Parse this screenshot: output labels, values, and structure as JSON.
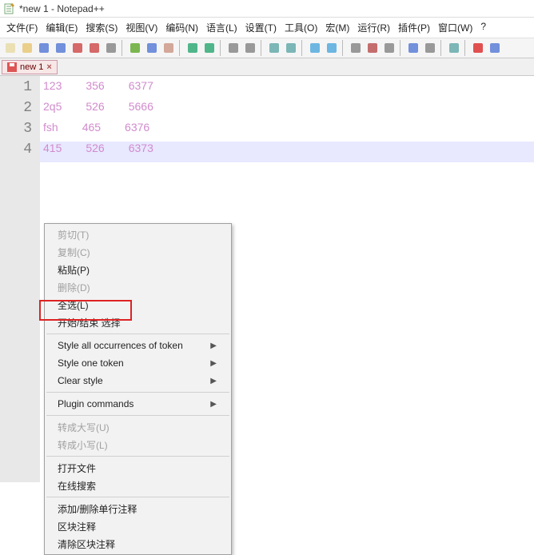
{
  "window": {
    "title": "*new 1 - Notepad++",
    "icon_name": "notepad-icon"
  },
  "menubar": {
    "items": [
      {
        "label": "文件(F)"
      },
      {
        "label": "编辑(E)"
      },
      {
        "label": "搜索(S)"
      },
      {
        "label": "视图(V)"
      },
      {
        "label": "编码(N)"
      },
      {
        "label": "语言(L)"
      },
      {
        "label": "设置(T)"
      },
      {
        "label": "工具(O)"
      },
      {
        "label": "宏(M)"
      },
      {
        "label": "运行(R)"
      },
      {
        "label": "插件(P)"
      },
      {
        "label": "窗口(W)"
      },
      {
        "label": "?"
      }
    ]
  },
  "toolbar": {
    "buttons": [
      {
        "name": "new-file-icon",
        "color": "#e8dca8"
      },
      {
        "name": "open-file-icon",
        "color": "#e8c878"
      },
      {
        "name": "save-icon",
        "color": "#5a7ed6"
      },
      {
        "name": "save-all-icon",
        "color": "#5a7ed6"
      },
      {
        "name": "close-icon",
        "color": "#d05050"
      },
      {
        "name": "close-all-icon",
        "color": "#d05050"
      },
      {
        "name": "print-icon",
        "color": "#888"
      },
      {
        "sep": true
      },
      {
        "name": "cut-icon",
        "color": "#6a3"
      },
      {
        "name": "copy-icon",
        "color": "#5a7ed6"
      },
      {
        "name": "paste-icon",
        "color": "#c98"
      },
      {
        "sep": true
      },
      {
        "name": "undo-icon",
        "color": "#3a7"
      },
      {
        "name": "redo-icon",
        "color": "#3a7"
      },
      {
        "sep": true
      },
      {
        "name": "find-icon",
        "color": "#888"
      },
      {
        "name": "replace-icon",
        "color": "#888"
      },
      {
        "sep": true
      },
      {
        "name": "zoom-in-icon",
        "color": "#6aa"
      },
      {
        "name": "zoom-out-icon",
        "color": "#6aa"
      },
      {
        "sep": true
      },
      {
        "name": "sync-v-icon",
        "color": "#5ad"
      },
      {
        "name": "sync-h-icon",
        "color": "#5ad"
      },
      {
        "sep": true
      },
      {
        "name": "wrap-icon",
        "color": "#888"
      },
      {
        "name": "show-all-icon",
        "color": "#b55"
      },
      {
        "name": "indent-guide-icon",
        "color": "#888"
      },
      {
        "sep": true
      },
      {
        "name": "lang-icon",
        "color": "#5a7ed6"
      },
      {
        "name": "doc-map-icon",
        "color": "#888"
      },
      {
        "sep": true
      },
      {
        "name": "monitor-icon",
        "color": "#6aa"
      },
      {
        "sep": true
      },
      {
        "name": "record-icon",
        "color": "#d33"
      },
      {
        "name": "play-icon",
        "color": "#5a7ed6"
      }
    ]
  },
  "tabs": {
    "items": [
      {
        "label": "new 1",
        "dirty": true
      }
    ]
  },
  "editor": {
    "lines": [
      {
        "n": "1",
        "tokens": [
          "123",
          "356",
          "6377"
        ]
      },
      {
        "n": "2",
        "tokens": [
          "2q5",
          "526",
          "5666"
        ]
      },
      {
        "n": "3",
        "tokens": [
          "fsh",
          "465",
          "6376"
        ]
      },
      {
        "n": "4",
        "tokens": [
          "415",
          "526",
          "6373"
        ],
        "selected": true
      }
    ]
  },
  "context_menu": {
    "groups": [
      [
        {
          "label": "剪切(T)",
          "disabled": true
        },
        {
          "label": "复制(C)",
          "disabled": true
        },
        {
          "label": "粘贴(P)"
        },
        {
          "label": "删除(D)",
          "disabled": true
        },
        {
          "label": "全选(L)"
        },
        {
          "label": "开始/结束 选择",
          "highlighted": true
        }
      ],
      [
        {
          "label": "Style all occurrences of token",
          "sub": true
        },
        {
          "label": "Style one token",
          "sub": true
        },
        {
          "label": "Clear style",
          "sub": true
        }
      ],
      [
        {
          "label": "Plugin commands",
          "sub": true
        }
      ],
      [
        {
          "label": "转成大写(U)",
          "disabled": true
        },
        {
          "label": "转成小写(L)",
          "disabled": true
        }
      ],
      [
        {
          "label": "打开文件"
        },
        {
          "label": "在线搜索"
        }
      ],
      [
        {
          "label": "添加/删除单行注释"
        },
        {
          "label": "区块注释"
        },
        {
          "label": "清除区块注释"
        }
      ]
    ]
  }
}
